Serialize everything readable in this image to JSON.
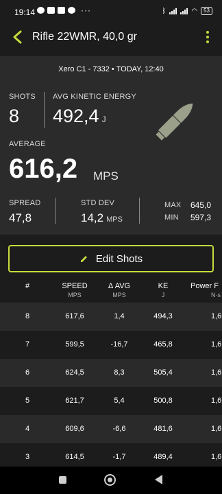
{
  "status_bar": {
    "time": "19:14",
    "dots": "···",
    "battery": "53"
  },
  "app_bar": {
    "title": "Rifle 22WMR, 40,0 gr"
  },
  "session": {
    "info": "Xero C1 - 7332 • TODAY, 12:40"
  },
  "stats": {
    "shots_label": "SHOTS",
    "shots_value": "8",
    "avg_ke_label": "AVG KINETIC ENERGY",
    "avg_ke_value": "492,4",
    "avg_ke_unit": "J",
    "average_label": "AVERAGE",
    "average_value": "616,2",
    "average_unit": "MPS",
    "spread_label": "SPREAD",
    "spread_value": "47,8",
    "std_dev_label": "STD DEV",
    "std_dev_value": "14,2",
    "std_dev_unit": "MPS",
    "max_label": "MAX",
    "max_value": "645,0",
    "min_label": "MIN",
    "min_value": "597,3"
  },
  "edit_button": {
    "label": "Edit Shots"
  },
  "table": {
    "headers": [
      {
        "label": "#",
        "unit": ""
      },
      {
        "label": "SPEED",
        "unit": "MPS"
      },
      {
        "label": "Δ AVG",
        "unit": "MPS"
      },
      {
        "label": "KE",
        "unit": "J"
      },
      {
        "label": "Power F",
        "unit": "N·s"
      }
    ],
    "rows": [
      {
        "num": "8",
        "speed": "617,6",
        "delta": "1,4",
        "ke": "494,3",
        "power": "1,6"
      },
      {
        "num": "7",
        "speed": "599,5",
        "delta": "-16,7",
        "ke": "465,8",
        "power": "1,6"
      },
      {
        "num": "6",
        "speed": "624,5",
        "delta": "8,3",
        "ke": "505,4",
        "power": "1,6"
      },
      {
        "num": "5",
        "speed": "621,7",
        "delta": "5,4",
        "ke": "500,8",
        "power": "1,6"
      },
      {
        "num": "4",
        "speed": "609,6",
        "delta": "-6,6",
        "ke": "481,6",
        "power": "1,6"
      },
      {
        "num": "3",
        "speed": "614,5",
        "delta": "-1,7",
        "ke": "489,4",
        "power": "1,6"
      }
    ]
  },
  "colors": {
    "accent": "#c8dc3c",
    "background": "#1c1c1c",
    "card": "#2b2b2b"
  }
}
